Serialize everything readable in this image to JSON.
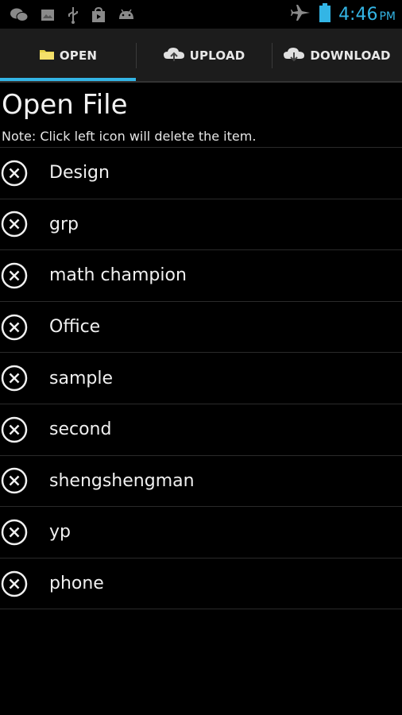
{
  "status_bar": {
    "icons": [
      "chat-icon",
      "image-icon",
      "usb-icon",
      "shop-icon",
      "android-icon"
    ],
    "right_icons": [
      "airplane-icon",
      "battery-icon"
    ],
    "time": "4:46",
    "ampm": "PM",
    "accent": "#33b5e5"
  },
  "tabs": [
    {
      "label": "OPEN",
      "icon": "folder-icon",
      "active": true
    },
    {
      "label": "UPLOAD",
      "icon": "cloud-upload-icon",
      "active": false
    },
    {
      "label": "DOWNLOAD",
      "icon": "cloud-download-icon",
      "active": false
    }
  ],
  "page": {
    "title": "Open File",
    "note": "Note: Click left icon will delete the item."
  },
  "files": [
    {
      "name": "Design"
    },
    {
      "name": "grp"
    },
    {
      "name": "math champion"
    },
    {
      "name": "Office"
    },
    {
      "name": "sample"
    },
    {
      "name": "second"
    },
    {
      "name": "shengshengman"
    },
    {
      "name": "yp"
    },
    {
      "name": "phone"
    }
  ]
}
